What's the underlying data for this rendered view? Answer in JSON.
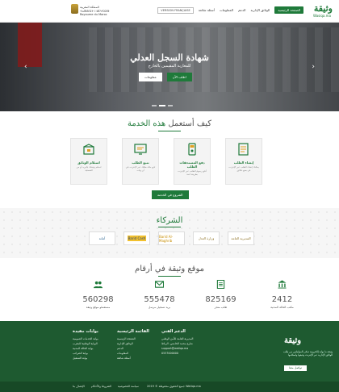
{
  "header": {
    "logo": {
      "mark": "وثيقة",
      "sub": "Wasiqa.ma"
    },
    "nav": [
      {
        "label": "الصفحة الرئيسية",
        "active": true
      },
      {
        "label": "الوثائق الإدارية",
        "active": false
      },
      {
        "label": "الدعم",
        "active": false
      },
      {
        "label": "المعلومات",
        "active": false
      },
      {
        "label": "أسئلة شائعة",
        "active": false
      }
    ],
    "nav_button": "VERSION FRANÇAISE",
    "gov": {
      "line1": "المملكة المغربية",
      "line2": "ⵜⴰⴳⵍⴷⵉⵜ ⵏ ⵍⵎⵖⵔⵉⴱ",
      "line3": "Royaume du Maroc"
    }
  },
  "hero": {
    "title": "شهادة السجل العدلي",
    "subtitle": "للمغاربة المقيمين بالخارج",
    "primary_btn": "اطلب الآن",
    "secondary_btn": "معلومات",
    "slides": 3,
    "active_slide": 1
  },
  "how": {
    "title_plain": "كيف أستعمل",
    "title_accent": " هذه الخدمة",
    "steps": [
      {
        "title": "إنشاء الطلب",
        "desc": "يمكنك إنشاء الطلب عبر الإنترنت في بضع دقائق"
      },
      {
        "title": "دفع المستحقات الطلب",
        "desc": "أدفع رسوم الطلب عبر الإنترنت بطريقة آمنة"
      },
      {
        "title": "تتبع الطلب",
        "desc": "تابع حالة طلبك عبر الإنترنت في أي وقت"
      },
      {
        "title": "استلام الوثائق",
        "desc": "استلم وثيقتك بالبريد أو من القنصلية"
      }
    ],
    "start_btn": "الشروع في الخدمة"
  },
  "partners": {
    "title": "الشركاء",
    "items": [
      "المديرية العامة",
      "وزارة العدل",
      "Barid Al-Maghrib",
      "Barid Cash",
      "أمانة"
    ]
  },
  "stats": {
    "title": "موقع وثيقة في أرقام",
    "items": [
      {
        "icon": "building-icon",
        "num": "2412",
        "label": "مكتب الحالة المدنية"
      },
      {
        "icon": "document-icon",
        "num": "825169",
        "label": "طلب منجز"
      },
      {
        "icon": "envelope-icon",
        "num": "555478",
        "label": "بريد تسجيل مرسل"
      },
      {
        "icon": "users-icon",
        "num": "560298",
        "label": "مستعملو موقع وثيقة"
      }
    ]
  },
  "footer": {
    "desc": "وثيقة.ما بوابة إلكترونية تمكن المواطنين من طلب الوثائق الإدارية عبر الإنترنت وتتبعها واستلامها",
    "btn": "تواصل معنا",
    "contact": {
      "title": "الدعم الفني",
      "lines": [
        "المديرية العامة للأمن الوطني",
        "شارع محمد الخامس، الرباط",
        "support@watiqa.ma",
        "0537000000"
      ]
    },
    "quick": {
      "title": "القائمة الرئيسية",
      "lines": [
        "الصفحة الرئيسية",
        "الوثائق الإدارية",
        "الدعم",
        "المعلومات",
        "أسئلة شائعة"
      ]
    },
    "portals": {
      "title": "بوابات مفيدة",
      "lines": [
        "بوابة الخدمات العمومية",
        "البوابة الوطنية للمغرب",
        "بوابة الحالة المدنية",
        "بوابة الضرائب",
        "بوابة التشغيل"
      ]
    },
    "bottom_links": [
      "سياسة الخصوصية",
      "الشروط والأحكام",
      "الإتصال بنا"
    ],
    "copyright": "جميع الحقوق محفوظة © 2019 Watiqa.ma"
  }
}
